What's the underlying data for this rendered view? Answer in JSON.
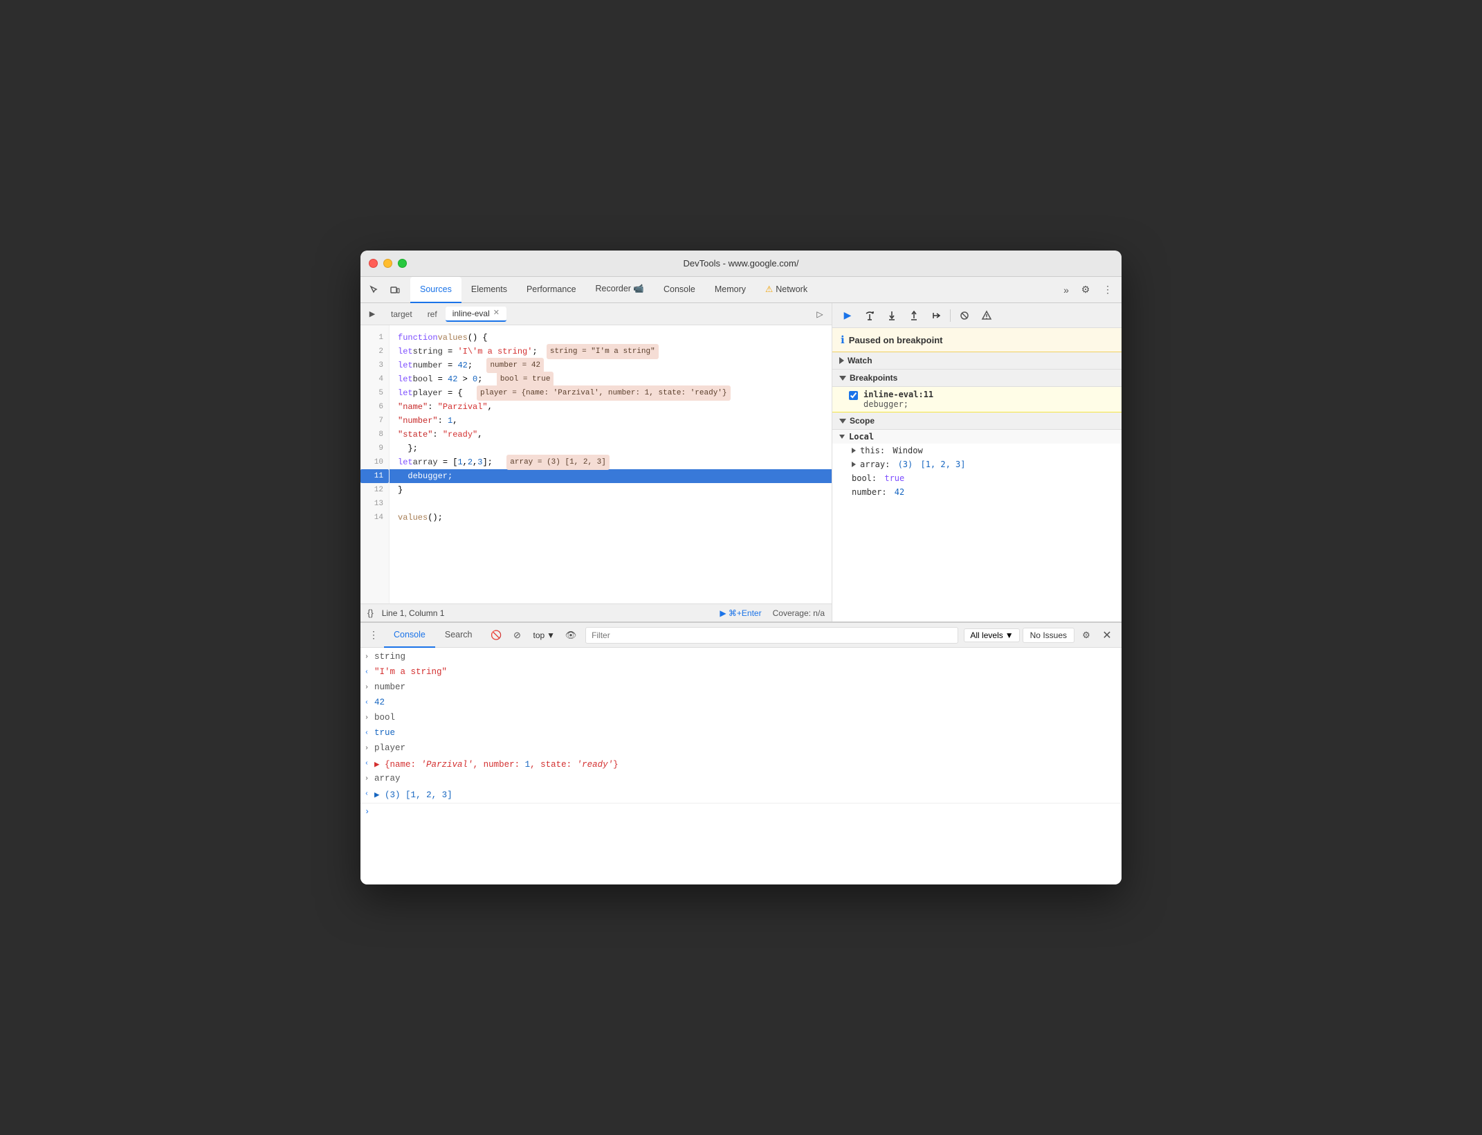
{
  "window": {
    "title": "DevTools - www.google.com/"
  },
  "nav": {
    "tabs": [
      {
        "label": "Sources",
        "active": true
      },
      {
        "label": "Elements",
        "active": false
      },
      {
        "label": "Performance",
        "active": false
      },
      {
        "label": "Recorder",
        "active": false,
        "icon": "📹"
      },
      {
        "label": "Console",
        "active": false
      },
      {
        "label": "Memory",
        "active": false
      },
      {
        "label": "Network",
        "active": false,
        "warning": true
      }
    ],
    "more_label": "»",
    "settings_icon": "⚙",
    "menu_icon": "⋮"
  },
  "source_tabs": [
    {
      "label": "target",
      "closeable": false
    },
    {
      "label": "ref",
      "closeable": false
    },
    {
      "label": "inline-eval",
      "closeable": true,
      "active": true
    }
  ],
  "code": {
    "lines": [
      {
        "num": 1,
        "content": "function values() {"
      },
      {
        "num": 2,
        "content": "  let string = 'I\\'m a string';",
        "eval": "string = \"I'm a string\""
      },
      {
        "num": 3,
        "content": "  let number = 42;",
        "eval": "number = 42"
      },
      {
        "num": 4,
        "content": "  let bool = 42 > 0;",
        "eval": "bool = true"
      },
      {
        "num": 5,
        "content": "  let player = {  player = {name: 'Parzival', number: 1, state: 'ready'}"
      },
      {
        "num": 6,
        "content": "    \"name\": \"Parzival\","
      },
      {
        "num": 7,
        "content": "    \"number\": 1,"
      },
      {
        "num": 8,
        "content": "    \"state\": \"ready\","
      },
      {
        "num": 9,
        "content": "  };"
      },
      {
        "num": 10,
        "content": "  let array = [1,2,3];",
        "eval": "array = (3) [1, 2, 3]"
      },
      {
        "num": 11,
        "content": "  debugger;",
        "current": true
      },
      {
        "num": 12,
        "content": "}"
      },
      {
        "num": 13,
        "content": ""
      },
      {
        "num": 14,
        "content": "values();"
      }
    ]
  },
  "status_bar": {
    "curly_label": "{}",
    "position": "Line 1, Column 1",
    "run_label": "▶ ⌘+Enter",
    "coverage": "Coverage: n/a"
  },
  "debugger": {
    "paused_message": "Paused on breakpoint",
    "watch_label": "Watch",
    "breakpoints_label": "Breakpoints",
    "breakpoint_file": "inline-eval:11",
    "breakpoint_code": "debugger;",
    "scope_label": "Scope",
    "local_label": "Local",
    "scope_items": [
      {
        "key": "this:",
        "val": "Window",
        "indent": 1
      },
      {
        "key": "array:",
        "val": "(3) [1, 2, 3]",
        "indent": 1,
        "expandable": true
      },
      {
        "key": "bool:",
        "val": "true",
        "indent": 1
      },
      {
        "key": "number:",
        "val": "42",
        "indent": 1
      }
    ]
  },
  "console": {
    "tabs": [
      "Console",
      "Search"
    ],
    "active_tab": "Console",
    "filter_placeholder": "Filter",
    "level_label": "All levels",
    "no_issues_label": "No Issues",
    "context_label": "top",
    "entries": [
      {
        "type": "input",
        "text": "string"
      },
      {
        "type": "output",
        "text": "\"I'm a string\"",
        "color": "string"
      },
      {
        "type": "input",
        "text": "number"
      },
      {
        "type": "output",
        "text": "42",
        "color": "blue"
      },
      {
        "type": "input",
        "text": "bool"
      },
      {
        "type": "output",
        "text": "true",
        "color": "blue"
      },
      {
        "type": "input",
        "text": "player"
      },
      {
        "type": "output",
        "text": "▶ {name: 'Parzival', number: 1, state: 'ready'}",
        "color": "string"
      },
      {
        "type": "input",
        "text": "array"
      },
      {
        "type": "output",
        "text": "▶ (3) [1, 2, 3]",
        "color": "blue"
      }
    ]
  }
}
